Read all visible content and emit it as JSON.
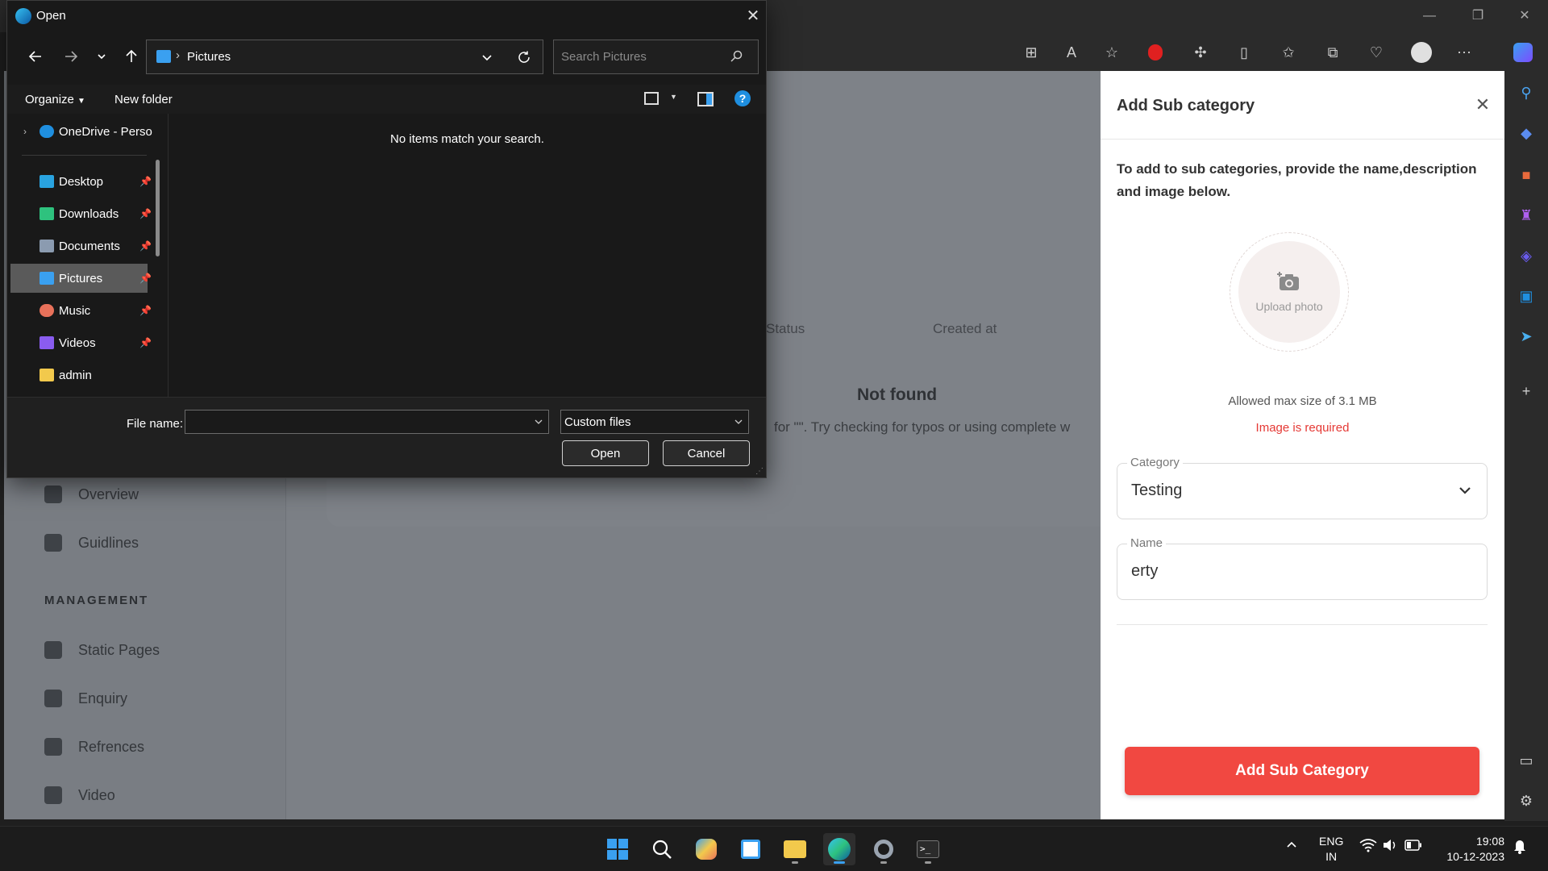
{
  "dialog": {
    "title": "Open",
    "breadcrumb": "Pictures",
    "search_placeholder": "Search Pictures",
    "organize_label": "Organize",
    "new_folder_label": "New folder",
    "empty_message": "No items match your search.",
    "tree": [
      {
        "label": "OneDrive - Perso",
        "icon": "onedrive-icon",
        "color": "#1f8fe0",
        "pinned": false
      },
      {
        "label": "Desktop",
        "icon": "desktop-folder-icon",
        "color": "#29a3e0",
        "pinned": true
      },
      {
        "label": "Downloads",
        "icon": "downloads-folder-icon",
        "color": "#2ec27e",
        "pinned": true
      },
      {
        "label": "Documents",
        "icon": "documents-folder-icon",
        "color": "#8b9bb0",
        "pinned": true
      },
      {
        "label": "Pictures",
        "icon": "pictures-folder-icon",
        "color": "#3aa0f0",
        "pinned": true,
        "selected": true
      },
      {
        "label": "Music",
        "icon": "music-folder-icon",
        "color": "#e8715a",
        "pinned": true
      },
      {
        "label": "Videos",
        "icon": "videos-folder-icon",
        "color": "#8a5cf0",
        "pinned": true
      },
      {
        "label": "admin",
        "icon": "folder-icon",
        "color": "#f2c94c",
        "pinned": false
      }
    ],
    "file_name_label": "File name:",
    "file_name_value": "",
    "file_type": "Custom files",
    "open_label": "Open",
    "cancel_label": "Cancel"
  },
  "page": {
    "nav_items": [
      {
        "label": "Overview",
        "icon": "overview-icon"
      },
      {
        "label": "Guidlines",
        "icon": "guidelines-icon"
      }
    ],
    "section_label": "MANAGEMENT",
    "management_items": [
      {
        "label": "Static Pages",
        "icon": "static-pages-icon"
      },
      {
        "label": "Enquiry",
        "icon": "enquiry-icon"
      },
      {
        "label": "Refrences",
        "icon": "references-icon"
      },
      {
        "label": "Video",
        "icon": "video-icon"
      }
    ],
    "table_headers": [
      "Status",
      "Created at"
    ],
    "not_found_title": "Not found",
    "not_found_text": "for \"\". Try checking for typos or using complete w"
  },
  "panel": {
    "title": "Add Sub category",
    "description": "To add to sub categories, provide the name,description and image below.",
    "upload_label": "Upload photo",
    "allowed_size": "Allowed max size of 3.1 MB",
    "error": "Image is required",
    "category_label": "Category",
    "category_value": "Testing",
    "name_label": "Name",
    "name_value": "erty",
    "submit_label": "Add Sub Category",
    "accent": "#f14841"
  },
  "taskbar": {
    "apps": [
      "start-icon",
      "search-icon",
      "copilot-pre-icon",
      "store-icon",
      "file-explorer-icon",
      "edge-icon",
      "settings-icon",
      "terminal-icon"
    ],
    "lang_line1": "ENG",
    "lang_line2": "IN",
    "time": "19:08",
    "date": "10-12-2023"
  }
}
